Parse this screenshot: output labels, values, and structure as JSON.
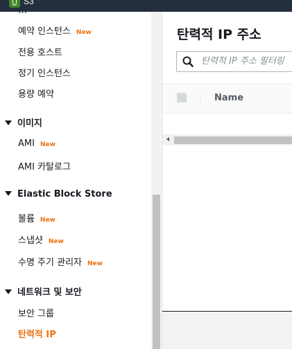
{
  "topbar": {
    "service_name": "S3"
  },
  "sidebar": {
    "items_top": [
      {
        "label": "예약 인스턴스",
        "badge": "New"
      },
      {
        "label": "전용 호스트",
        "badge": ""
      },
      {
        "label": "정기 인스턴스",
        "badge": ""
      },
      {
        "label": "용량 예약",
        "badge": ""
      }
    ],
    "sections": [
      {
        "title": "이미지",
        "items": [
          {
            "label": "AMI",
            "badge": "New"
          },
          {
            "label": "AMI 카탈로그",
            "badge": ""
          }
        ]
      },
      {
        "title": "Elastic Block Store",
        "items": [
          {
            "label": "볼륨",
            "badge": "New"
          },
          {
            "label": "스냅샷",
            "badge": "New"
          },
          {
            "label": "수명 주기 관리자",
            "badge": "New"
          }
        ]
      },
      {
        "title": "네트워크 및 보안",
        "items": [
          {
            "label": "보안 그룹",
            "badge": ""
          },
          {
            "label": "탄력적 IP",
            "badge": ""
          }
        ]
      }
    ]
  },
  "main": {
    "title": "탄력적 IP 주소",
    "search_placeholder": "탄력적 IP 주소 필터링",
    "columns": [
      "Name"
    ]
  },
  "colors": {
    "accent": "#ec7211",
    "topbar": "#232f3e",
    "text": "#16191f"
  }
}
